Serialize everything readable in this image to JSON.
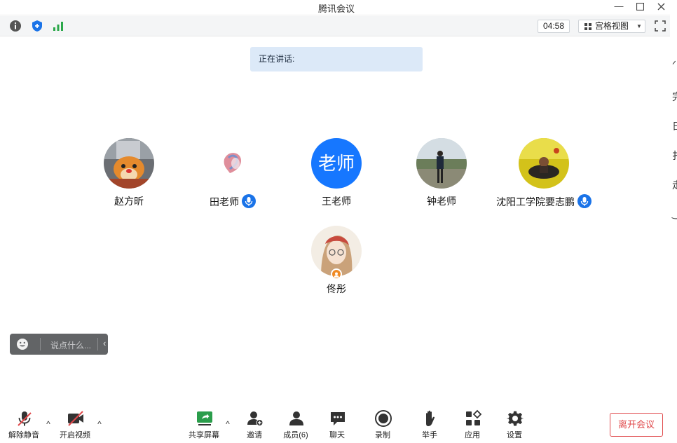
{
  "window": {
    "title": "腾讯会议"
  },
  "toolbar": {
    "timer": "04:58",
    "view_label": "宫格视图"
  },
  "speaking": {
    "label": "正在讲话:"
  },
  "participants": [
    {
      "name": "赵方昕"
    },
    {
      "name": "田老师"
    },
    {
      "name": "王老师",
      "avatar_text": "老师"
    },
    {
      "name": "钟老师"
    },
    {
      "name": "沈阳工学院要志鹏"
    },
    {
      "name": "佟彤"
    }
  ],
  "chat": {
    "placeholder": "说点什么..."
  },
  "controls": {
    "unmute": "解除静音",
    "start_video": "开启视频",
    "share_screen": "共享屏幕",
    "invite": "邀请",
    "members": "成员(6)",
    "chat": "聊天",
    "record": "录制",
    "raise_hand": "举手",
    "apps": "应用",
    "settings": "设置",
    "leave": "离开会议"
  },
  "colors": {
    "accent": "#1a73e8",
    "danger": "#e0494b",
    "host_badge": "#f08a24"
  }
}
